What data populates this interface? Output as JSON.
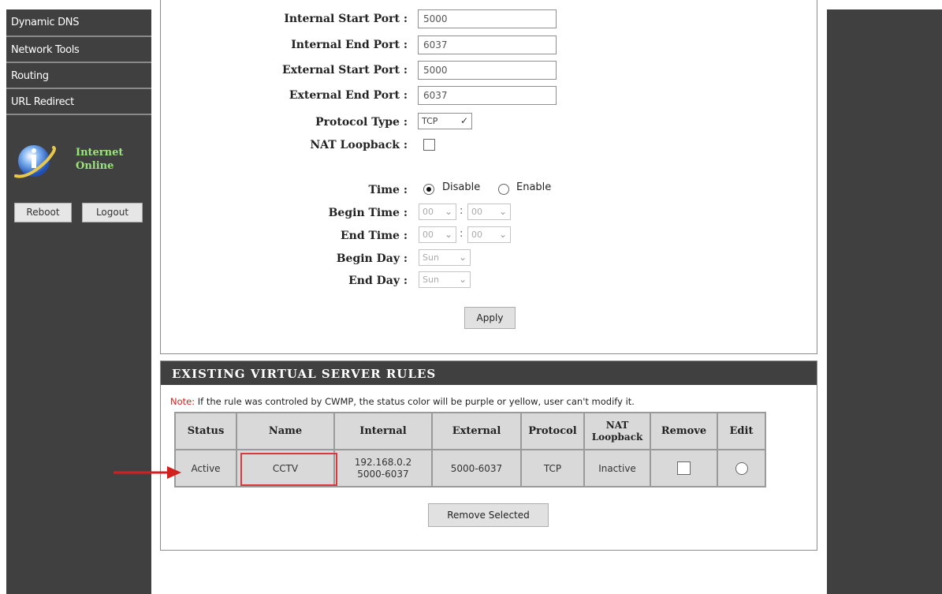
{
  "sidebar": {
    "menu": [
      "Dynamic DNS",
      "Network Tools",
      "Routing",
      "URL Redirect"
    ],
    "status_line1": "Internet",
    "status_line2": "Online",
    "reboot_label": "Reboot",
    "logout_label": "Logout"
  },
  "form": {
    "internal_start_port": {
      "label": "Internal Start Port :",
      "value": "5000"
    },
    "internal_end_port": {
      "label": "Internal End Port :",
      "value": "6037"
    },
    "external_start_port": {
      "label": "External Start Port :",
      "value": "5000"
    },
    "external_end_port": {
      "label": "External End Port :",
      "value": "6037"
    },
    "protocol_type": {
      "label": "Protocol Type :",
      "value": "TCP"
    },
    "nat_loopback": {
      "label": "NAT Loopback :",
      "checked": false
    },
    "time": {
      "label": "Time :",
      "disable_label": "Disable",
      "enable_label": "Enable",
      "selected": "Disable"
    },
    "begin_time": {
      "label": "Begin Time :",
      "hour": "00",
      "minute": "00"
    },
    "end_time": {
      "label": "End Time :",
      "hour": "00",
      "minute": "00"
    },
    "begin_day": {
      "label": "Begin Day :",
      "value": "Sun"
    },
    "end_day": {
      "label": "End Day :",
      "value": "Sun"
    },
    "colon": ":",
    "apply_label": "Apply"
  },
  "rules": {
    "header": "EXISTING VIRTUAL SERVER RULES",
    "note_key": "Note:",
    "note_text": " If the rule was controled by CWMP, the status color will be purple or yellow, user can't modify it.",
    "columns": [
      "Status",
      "Name",
      "Internal",
      "External",
      "Protocol",
      "NAT Loopback",
      "Remove",
      "Edit"
    ],
    "row": {
      "status": "Active",
      "name": "CCTV",
      "internal_ip": "192.168.0.2",
      "internal_ports": "5000-6037",
      "external": "5000-6037",
      "protocol": "TCP",
      "nat_loopback": "Inactive"
    },
    "remove_selected_label": "Remove Selected"
  },
  "colors": {
    "sidebar_bg": "#404040",
    "status_green": "#9be37d",
    "active_blue": "#1e3bd6",
    "inactive_red": "#d41f1f",
    "highlight_red": "#d9393b"
  },
  "icons": [
    "internet-globe-icon",
    "chevron-down-icon",
    "red-arrow-icon"
  ]
}
